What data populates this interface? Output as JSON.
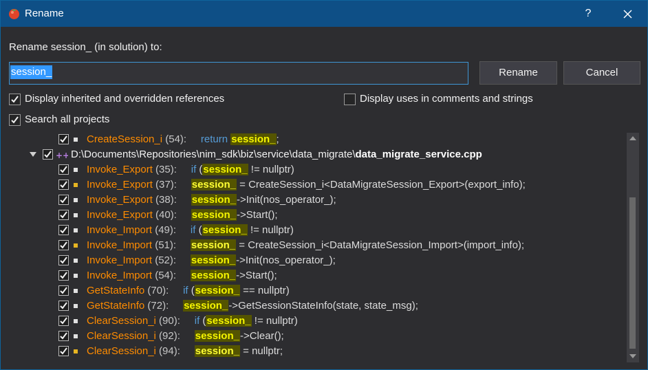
{
  "window": {
    "title": "Rename",
    "help_label": "?",
    "icon": "tomato-icon"
  },
  "prompt": "Rename session_ (in solution) to:",
  "input": {
    "value": "session_"
  },
  "buttons": {
    "rename": "Rename",
    "cancel": "Cancel"
  },
  "options": {
    "inherited": {
      "label": "Display inherited and overridden references",
      "checked": true
    },
    "comments": {
      "label": "Display uses in comments and strings",
      "checked": false
    },
    "all_projects": {
      "label": "Search all projects",
      "checked": true
    }
  },
  "file": {
    "path": "D:\\Documents\\Repositories\\nim_sdk\\biz\\service\\data_migrate\\",
    "name": "data_migrate_service.cpp"
  },
  "references": [
    {
      "fn": "CreateSession_i",
      "line": " (54):",
      "pre_kw": "return",
      "pre": "",
      "hl": "session_",
      "post_op": ";",
      "write": false
    },
    {
      "fn": "Invoke_Export",
      "line": " (35):",
      "pre_kw": "if",
      "pre": "(",
      "hl": "session_",
      "post_op": " != nullptr)",
      "write": false
    },
    {
      "fn": "Invoke_Export",
      "line": " (37):",
      "pre_kw": "",
      "pre": "",
      "hl": "session_",
      "post_op": " = CreateSession_i<DataMigrateSession_Export>(export_info);",
      "write": true
    },
    {
      "fn": "Invoke_Export",
      "line": " (38):",
      "pre_kw": "",
      "pre": "",
      "hl": "session_",
      "post_op": "->Init(nos_operator_);",
      "write": false
    },
    {
      "fn": "Invoke_Export",
      "line": " (40):",
      "pre_kw": "",
      "pre": "",
      "hl": "session_",
      "post_op": "->Start();",
      "write": false
    },
    {
      "fn": "Invoke_Import",
      "line": " (49):",
      "pre_kw": "if",
      "pre": "(",
      "hl": "session_",
      "post_op": " != nullptr)",
      "write": false
    },
    {
      "fn": "Invoke_Import",
      "line": " (51):",
      "pre_kw": "",
      "pre": "",
      "hl": "session_",
      "post_op": " = CreateSession_i<DataMigrateSession_Import>(import_info);",
      "write": true
    },
    {
      "fn": "Invoke_Import",
      "line": " (52):",
      "pre_kw": "",
      "pre": "",
      "hl": "session_",
      "post_op": "->Init(nos_operator_);",
      "write": false
    },
    {
      "fn": "Invoke_Import",
      "line": " (54):",
      "pre_kw": "",
      "pre": "",
      "hl": "session_",
      "post_op": "->Start();",
      "write": false
    },
    {
      "fn": "GetStateInfo",
      "line": " (70):",
      "pre_kw": "if",
      "pre": "(",
      "hl": "session_",
      "post_op": " == nullptr)",
      "write": false
    },
    {
      "fn": "GetStateInfo",
      "line": " (72):",
      "pre_kw": "",
      "pre": "",
      "hl": "session_",
      "post_op": "->GetSessionStateInfo(state, state_msg);",
      "write": false
    },
    {
      "fn": "ClearSession_i",
      "line": " (90):",
      "pre_kw": "if",
      "pre": "(",
      "hl": "session_",
      "post_op": " != nullptr)",
      "write": false
    },
    {
      "fn": "ClearSession_i",
      "line": " (92):",
      "pre_kw": "",
      "pre": "",
      "hl": "session_",
      "post_op": "->Clear();",
      "write": false
    },
    {
      "fn": "ClearSession_i",
      "line": " (94):",
      "pre_kw": "",
      "pre": "",
      "hl": "session_",
      "post_op": " = nullptr;",
      "write": true
    }
  ],
  "colors": {
    "titlebar": "#0e4f86",
    "background": "#2d2d30",
    "function": "#ff8c00",
    "keyword": "#569cd6",
    "highlight_bg": "#545400",
    "highlight_fg": "#f5f500"
  }
}
